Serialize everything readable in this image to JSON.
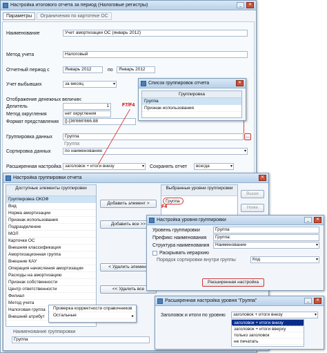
{
  "main": {
    "title": "Настройка итогового отчета за период (Налоговые регистры)",
    "tabs": [
      "Параметры",
      "Ограничения по картотеке ОС"
    ],
    "name_label": "Наименование",
    "name_value": "Учет амортизации ОС (январь 2012)",
    "method_label": "Метод учета",
    "method_value": "Налоговый",
    "period_label": "Отчетный период с",
    "period_from": "Январь 2012",
    "period_to_label": "по",
    "period_to": "Январь 2012",
    "entries_label": "Учет выбывших",
    "entries_value": "за месяц",
    "money_label": "Отображение денежных величин:",
    "divider_label": "Делитель",
    "divider_value": "1",
    "rounding_label": "Метод округления",
    "rounding_value": "нет округления",
    "format_label": "Формат представления",
    "format_value": "[]-]36'666'666.88",
    "grouping_label": "Группировка данных",
    "grouping_value": "Группа",
    "grouping_sub": "Группа",
    "sort_label": "Сортировка данных",
    "sort_value": "по наименованию",
    "ext_label": "Расширенная настройка",
    "ext_value": "заголовок + итоги внизу",
    "save_label": "Сохранять отчет",
    "save_value": "всегда"
  },
  "popup_list": {
    "title": "Список группировок отчета",
    "header": "Группировка",
    "items": [
      "Группа",
      "Признак использования"
    ]
  },
  "group_settings": {
    "title": "Настройка группировки отчета",
    "available_header": "Доступные элементы группировки",
    "items": [
      "Группировка ОКОФ",
      "Вид",
      "Норма амортизации",
      "Признак использования",
      "Подразделение",
      "МОЛ",
      "Карточки ОС",
      "Внешняя классификация",
      "Амортизационная группа",
      "Внешние КАУ",
      "Операция начисления амортизации",
      "Расходы на амортизацию",
      "Признак собственности",
      "Центр ответственности",
      "Филиал",
      "Метод учета",
      "Налоговая группа",
      "Внешний атрибут"
    ],
    "add_btn": "Добавить элемент >",
    "add_all_btn": "Добавить все >>",
    "remove_btn": "< Удалить элемент",
    "remove_all_btn": "<< Удалить все",
    "selected_header": "Выбранные уровни группировки",
    "selected_items": [
      "Группа"
    ],
    "up_btn": "Выше",
    "down_btn": "Ниже",
    "name_label": "Наименование группировки",
    "name_value": "Группа"
  },
  "context_menu": {
    "items": [
      "Проверка корректности справочников",
      "Остальные"
    ]
  },
  "level_settings": {
    "title": "Настройка уровня группировки",
    "level_label": "Уровень группировки",
    "level_value": "Группа",
    "prefix_label": "Префикс наименования",
    "prefix_value": "Группа:",
    "structure_label": "Структура наименования",
    "structure_value": "Наименование",
    "hide_label": "Раскрывать иерархию",
    "sort_label": "Порядок сортировки внутри группы",
    "sort_value": "Код",
    "ext_btn": "Расширенная настройка"
  },
  "ext_settings": {
    "title": "Расширенная настройка уровня \"Группа\"",
    "label": "Заголовок и итоги по уровню",
    "value": "заголовок + итоги внизу",
    "options": [
      "заголовок + итоги внизу",
      "заголовок + итоги вверху",
      "только заголовок",
      "не печатать"
    ]
  },
  "annotations": {
    "f7f4": "F7/F4",
    "f4": "F4"
  }
}
